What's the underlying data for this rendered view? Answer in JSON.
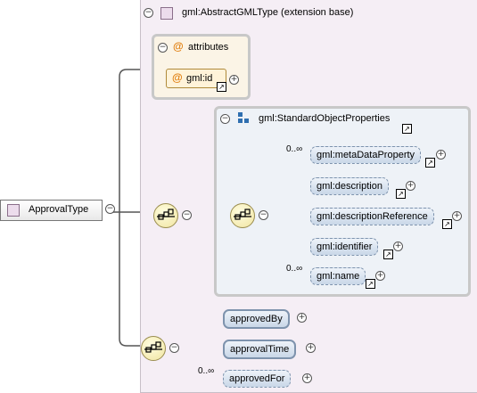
{
  "root": {
    "label": "ApprovalType"
  },
  "extension": {
    "label": "gml:AbstractGMLType (extension base)"
  },
  "attributes": {
    "header": "attributes",
    "items": [
      {
        "label": "gml:id"
      }
    ]
  },
  "group": {
    "label": "gml:StandardObjectProperties"
  },
  "group_elements": [
    {
      "label": "gml:metaDataProperty",
      "occurrence": "0..∞"
    },
    {
      "label": "gml:description",
      "occurrence": ""
    },
    {
      "label": "gml:descriptionReference",
      "occurrence": ""
    },
    {
      "label": "gml:identifier",
      "occurrence": ""
    },
    {
      "label": "gml:name",
      "occurrence": "0..∞"
    }
  ],
  "own_elements": [
    {
      "label": "approvedBy",
      "occurrence": ""
    },
    {
      "label": "approvalTime",
      "occurrence": ""
    },
    {
      "label": "approvedFor",
      "occurrence": "0..∞"
    }
  ],
  "colors": {
    "extension_bg": "#f5eef5",
    "attribute_bg": "#fbf4e6",
    "element_fill": "#c9d7e8",
    "compositor_fill": "#f0e4a0"
  },
  "icons": {
    "expand": "plus-icon",
    "collapse": "minus-icon",
    "reference": "reference-arrow-icon",
    "sequence": "sequence-compositor-icon",
    "attribute": "attribute-at-icon"
  }
}
